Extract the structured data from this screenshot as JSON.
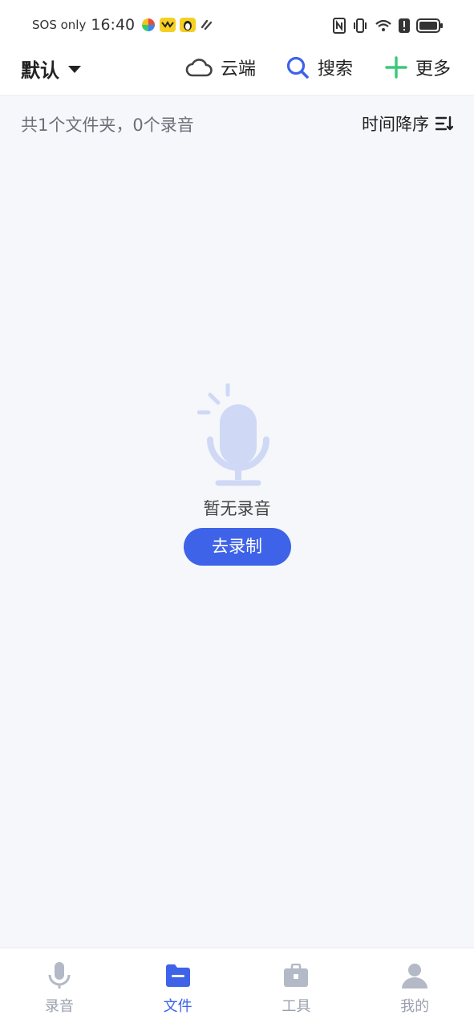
{
  "status_bar": {
    "carrier": "SOS only",
    "time": "16:40",
    "notification_icons": [
      "colorful-pinwheel-icon",
      "yellow-app-icon",
      "penguin-app-icon",
      "link-icon"
    ],
    "system_icons": [
      "nfc-icon",
      "vibrate-icon",
      "wifi-icon",
      "alert-icon",
      "battery-icon"
    ]
  },
  "topbar": {
    "folder_name": "默认",
    "cloud_label": "云端",
    "search_label": "搜索",
    "more_label": "更多"
  },
  "subheader": {
    "count_text": "共1个文件夹，0个录音",
    "sort_label": "时间降序"
  },
  "empty_state": {
    "message": "暂无录音",
    "record_button": "去录制"
  },
  "bottom_nav": {
    "items": [
      {
        "label": "录音",
        "icon": "mic-icon",
        "active": false
      },
      {
        "label": "文件",
        "icon": "folder-icon",
        "active": true
      },
      {
        "label": "工具",
        "icon": "toolbox-icon",
        "active": false
      },
      {
        "label": "我的",
        "icon": "user-icon",
        "active": false
      }
    ]
  },
  "colors": {
    "accent": "#3e63e8",
    "plus": "#3bc77a",
    "inactive": "#9aa0ad",
    "illustration": "#cfd9f5"
  }
}
